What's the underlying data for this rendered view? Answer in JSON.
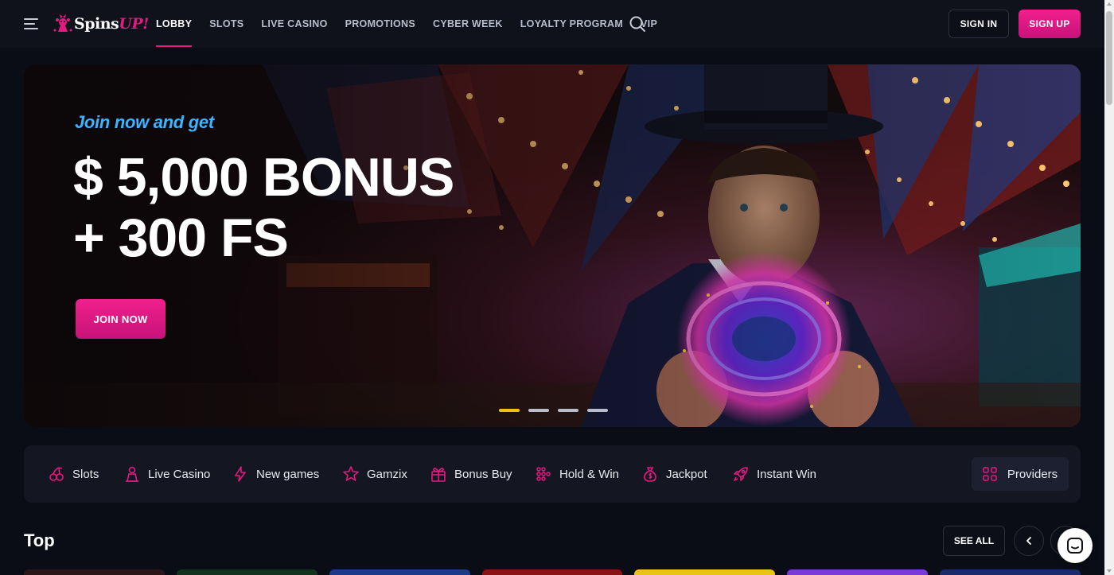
{
  "header": {
    "logo": {
      "text_main": "Spins",
      "text_accent": "UP!"
    },
    "nav": [
      {
        "label": "LOBBY",
        "active": true
      },
      {
        "label": "SLOTS"
      },
      {
        "label": "LIVE CASINO"
      },
      {
        "label": "PROMOTIONS"
      },
      {
        "label": "CYBER WEEK"
      },
      {
        "label": "LOYALTY PROGRAM"
      },
      {
        "label": "VIP"
      }
    ],
    "sign_in_label": "SIGN IN",
    "sign_up_label": "SIGN UP",
    "icons": {
      "menu": "hamburger-menu-icon",
      "search": "search-icon"
    }
  },
  "hero": {
    "subtitle": "Join now and get",
    "title_line1": "$ 5,000 BONUS",
    "title_line2": "+ 300 FS",
    "cta_label": "JOIN NOW",
    "slides_total": 4,
    "active_slide": 1
  },
  "categories": {
    "items": [
      {
        "label": "Slots",
        "icon": "cherry-icon"
      },
      {
        "label": "Live Casino",
        "icon": "dealer-icon"
      },
      {
        "label": "New games",
        "icon": "lightning-icon"
      },
      {
        "label": "Gamzix",
        "icon": "star-icon"
      },
      {
        "label": "Bonus Buy",
        "icon": "gift-icon"
      },
      {
        "label": "Hold & Win",
        "icon": "grid-dots-icon"
      },
      {
        "label": "Jackpot",
        "icon": "money-bag-icon"
      },
      {
        "label": "Instant Win",
        "icon": "rocket-icon"
      }
    ],
    "providers_label": "Providers"
  },
  "top_section": {
    "title": "Top",
    "see_all_label": "SEE ALL"
  },
  "colors": {
    "accent_pink": "#e3197f",
    "accent_blue": "#3cb4ff",
    "active_dot": "#f2c10e",
    "background": "#0b0d16"
  }
}
